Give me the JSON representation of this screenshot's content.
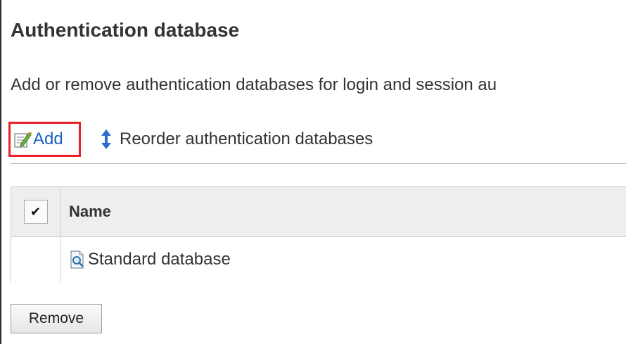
{
  "page": {
    "title": "Authentication database",
    "description": "Add or remove authentication databases for login and session au"
  },
  "actions": {
    "add_label": "Add",
    "reorder_label": "Reorder authentication databases"
  },
  "table": {
    "columns": [
      "✔",
      "Name"
    ],
    "rows": [
      {
        "name": "Standard database",
        "checked": false
      }
    ]
  },
  "buttons": {
    "remove_label": "Remove"
  },
  "colors": {
    "link": "#1a5fc1",
    "highlight_box": "#e8202a",
    "header_bg": "#eeeeee",
    "border": "#cfcfcf"
  },
  "icons": {
    "add": "edit-note-icon",
    "reorder": "up-down-arrow-icon",
    "database": "search-document-icon"
  }
}
